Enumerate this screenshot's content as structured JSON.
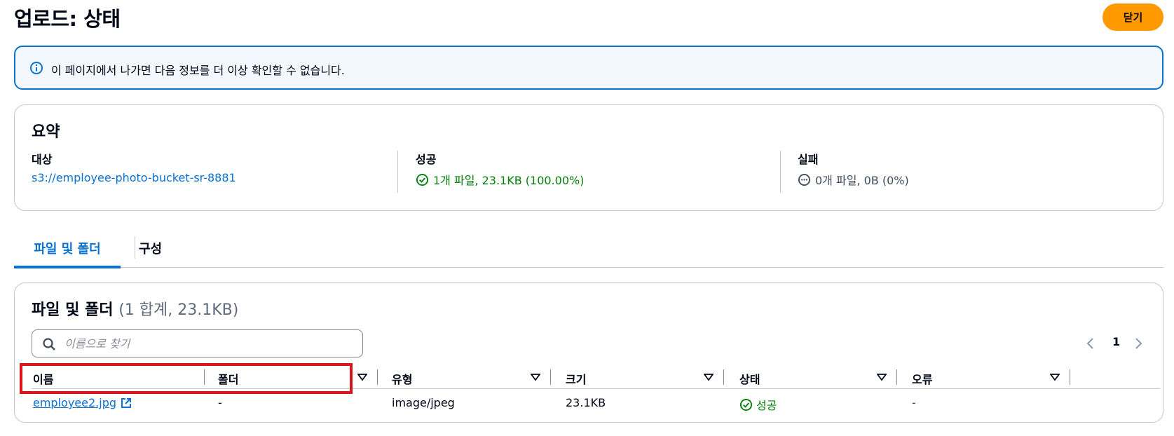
{
  "header": {
    "title": "업로드: 상태",
    "close_label": "닫기"
  },
  "banner": {
    "text": "이 페이지에서 나가면 다음 정보를 더 이상 확인할 수 없습니다."
  },
  "summary": {
    "title": "요약",
    "target_label": "대상",
    "target_value": "s3://employee-photo-bucket-sr-8881",
    "success_label": "성공",
    "success_value": "1개 파일, 23.1KB (100.00%)",
    "failure_label": "실패",
    "failure_value": "0개 파일, 0B (0%)"
  },
  "tabs": [
    {
      "label": "파일 및 폴더",
      "active": true
    },
    {
      "label": "구성",
      "active": false
    }
  ],
  "files": {
    "title": "파일 및 폴더",
    "count": "(1 합계, 23.1KB)",
    "search_placeholder": "이름으로 찾기",
    "page": "1",
    "columns": [
      "이름",
      "폴더",
      "유형",
      "크기",
      "상태",
      "오류"
    ],
    "rows": [
      {
        "name": "employee2.jpg",
        "folder": "-",
        "type": "image/jpeg",
        "size": "23.1KB",
        "status": "성공",
        "error": "-"
      }
    ]
  },
  "colors": {
    "accent": "#0972d3",
    "primary_button": "#ff9900",
    "success": "#037f0c",
    "highlight": "#d8161c"
  },
  "icons": {
    "banner": "info-icon",
    "success": "check-circle-icon",
    "failure": "ellipsis-circle-icon",
    "search": "search-icon",
    "external": "external-link-icon",
    "sort": "caret-down-icon",
    "pager_prev": "chevron-left-icon",
    "pager_next": "chevron-right-icon"
  }
}
